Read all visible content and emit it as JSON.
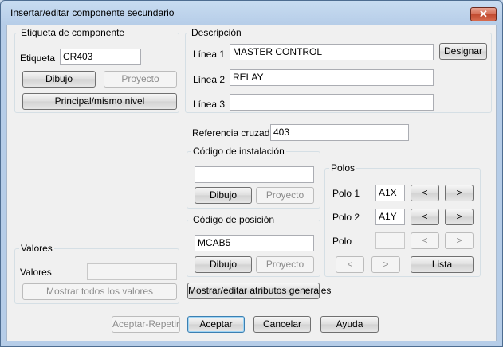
{
  "window": {
    "title": "Insertar/editar componente secundario",
    "close_label": "✕"
  },
  "etiqueta_group": {
    "title": "Etiqueta de componente",
    "etiqueta_label": "Etiqueta",
    "etiqueta_value": "CR403",
    "dibujo_label": "Dibujo",
    "proyecto_label": "Proyecto",
    "principal_label": "Principal/mismo nivel"
  },
  "descripcion_group": {
    "title": "Descripción",
    "lines": [
      {
        "label": "Línea 1",
        "value": "MASTER CONTROL"
      },
      {
        "label": "Línea 2",
        "value": "RELAY"
      },
      {
        "label": "Línea 3",
        "value": ""
      }
    ],
    "designar_label": "Designar"
  },
  "referencia": {
    "label": "Referencia cruzada",
    "value": "403"
  },
  "instalacion_group": {
    "title": "Código de instalación",
    "value": "",
    "dibujo_label": "Dibujo",
    "proyecto_label": "Proyecto"
  },
  "posicion_group": {
    "title": "Código de posición",
    "value": "MCAB5",
    "dibujo_label": "Dibujo",
    "proyecto_label": "Proyecto"
  },
  "polos_group": {
    "title": "Polos",
    "rows": [
      {
        "label": "Polo 1",
        "value": "A1X"
      },
      {
        "label": "Polo 2",
        "value": "A1Y"
      },
      {
        "label": "Polo",
        "value": ""
      }
    ],
    "prev_label": "<",
    "next_label": ">",
    "lista_label": "Lista"
  },
  "valores_group": {
    "title": "Valores",
    "valores_label": "Valores",
    "value": "",
    "mostrar_label": "Mostrar todos los valores"
  },
  "mostrar_atributos_label": "Mostrar/editar atributos generales",
  "footer": {
    "aceptar_repetir": "Aceptar-Repetir",
    "aceptar": "Aceptar",
    "cancelar": "Cancelar",
    "ayuda": "Ayuda"
  }
}
